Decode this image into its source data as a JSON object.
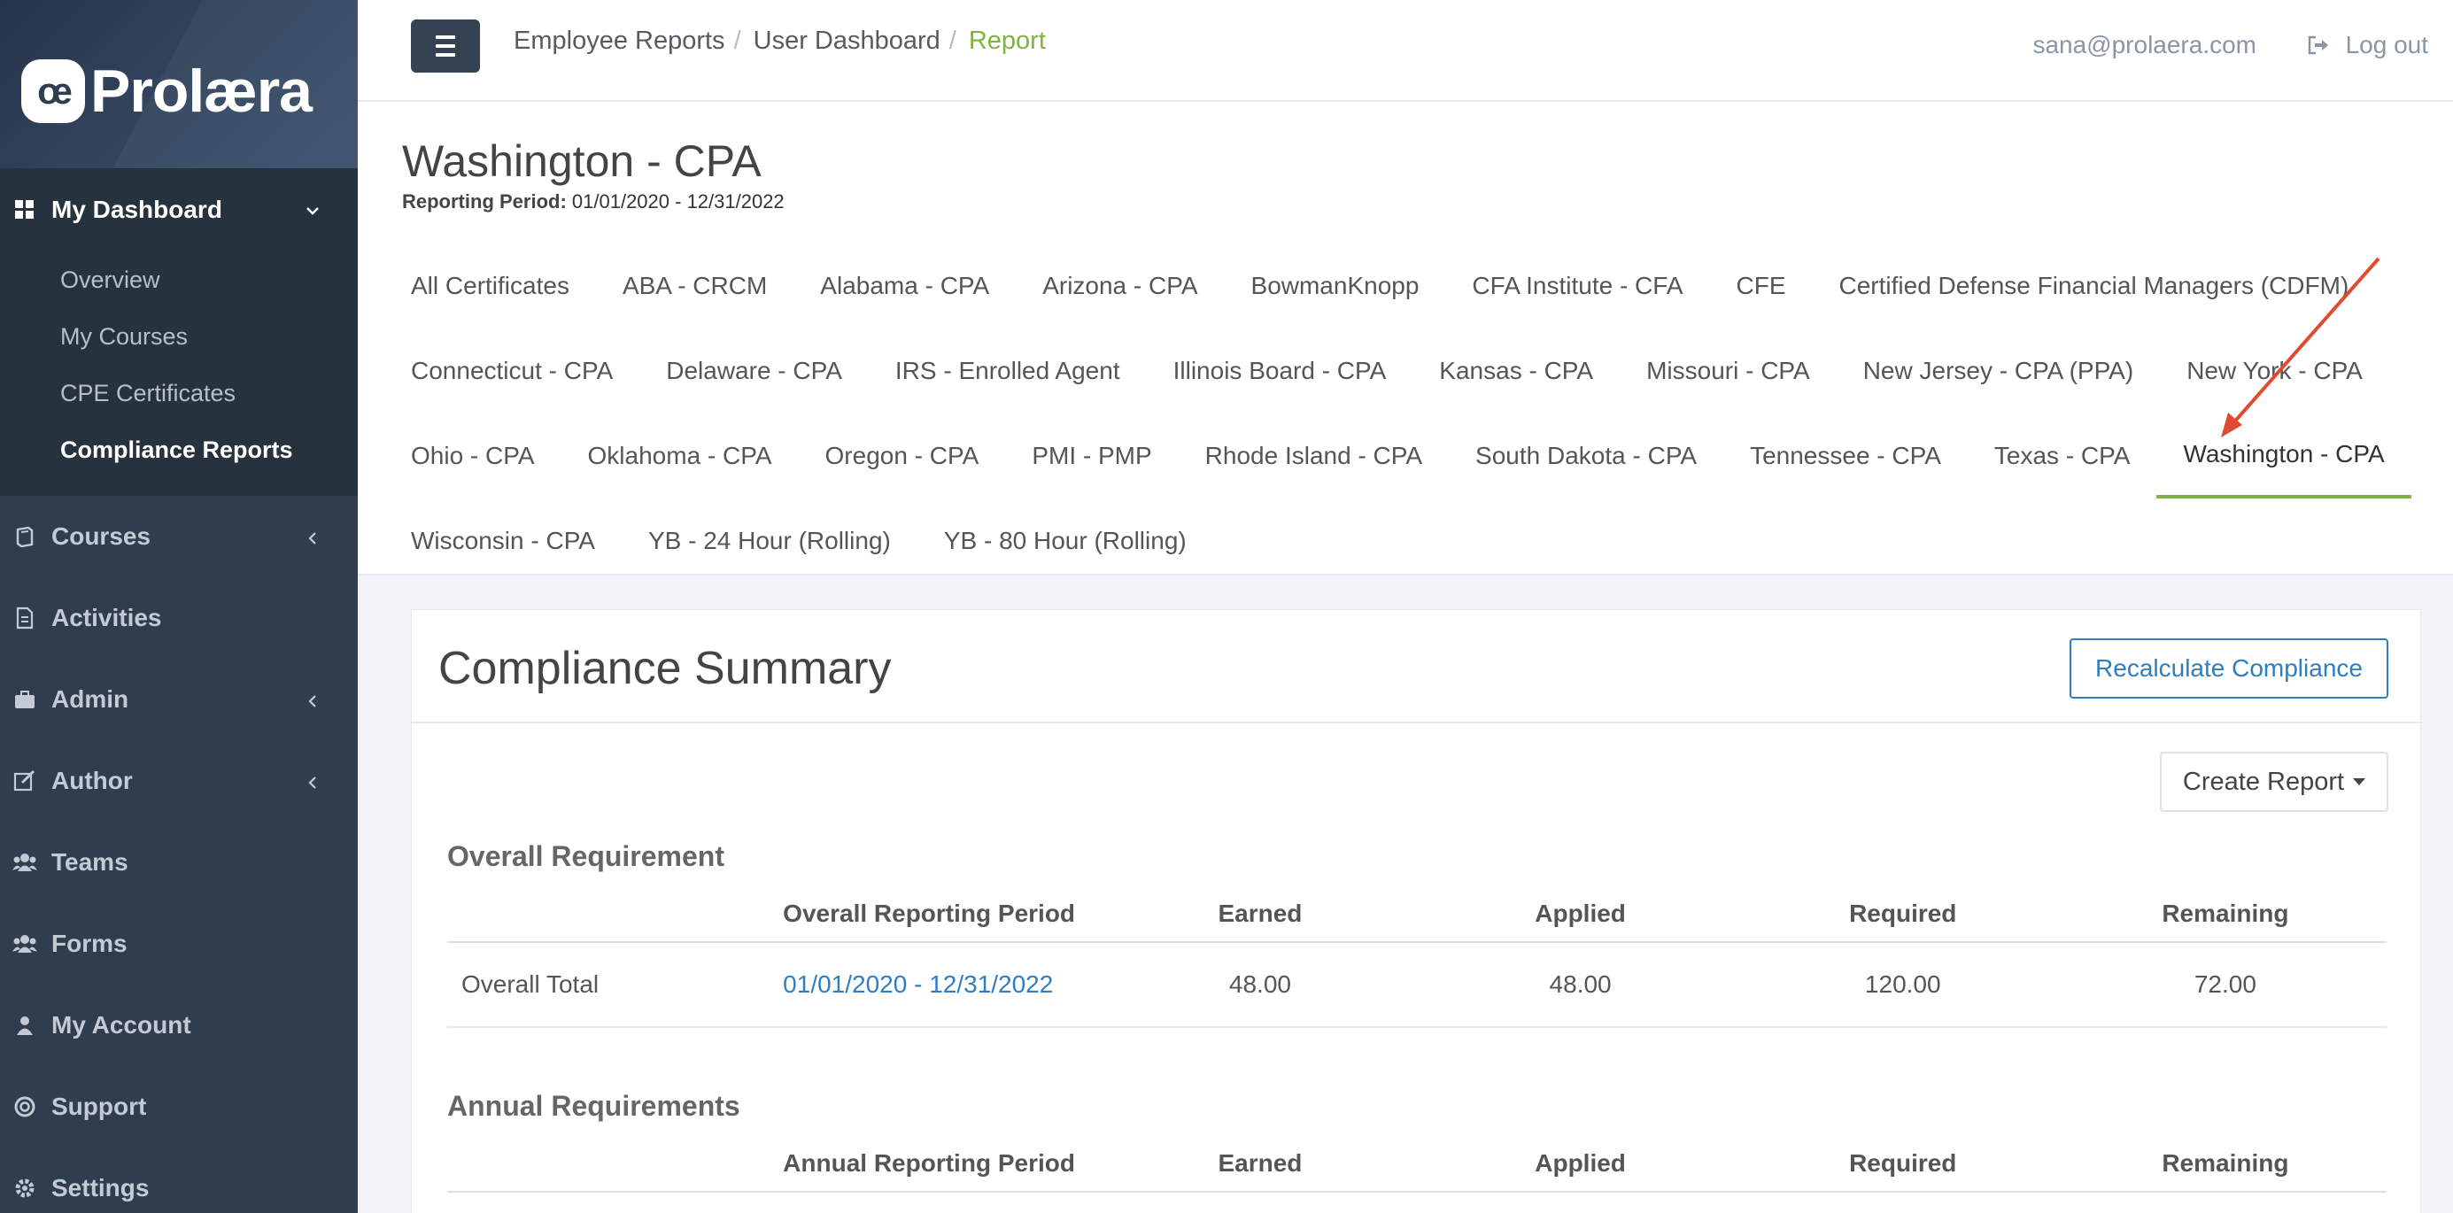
{
  "app": {
    "brand_badge": "œ",
    "brand_name": "Prolæra"
  },
  "sidebar": {
    "dashboard_label": "My Dashboard",
    "sub_items": [
      {
        "label": "Overview"
      },
      {
        "label": "My Courses"
      },
      {
        "label": "CPE Certificates"
      },
      {
        "label": "Compliance Reports"
      }
    ],
    "items": [
      {
        "label": "Courses",
        "icon": "book-icon"
      },
      {
        "label": "Activities",
        "icon": "document-icon"
      },
      {
        "label": "Admin",
        "icon": "briefcase-icon"
      },
      {
        "label": "Author",
        "icon": "edit-icon"
      },
      {
        "label": "Teams",
        "icon": "users-icon"
      },
      {
        "label": "Forms",
        "icon": "users-icon"
      },
      {
        "label": "My Account",
        "icon": "user-icon"
      },
      {
        "label": "Support",
        "icon": "lifebuoy-icon"
      },
      {
        "label": "Settings",
        "icon": "gear-icon"
      }
    ]
  },
  "header": {
    "breadcrumbs": [
      "Employee Reports",
      "User Dashboard",
      "Report"
    ],
    "breadcrumb_sep": "/",
    "user_email": "sana@prolaera.com",
    "logout_label": "Log out"
  },
  "page": {
    "title": "Washington - CPA",
    "period_label": "Reporting Period:",
    "period_value": "01/01/2020 - 12/31/2022"
  },
  "tabs": [
    [
      "All Certificates",
      "ABA - CRCM",
      "Alabama - CPA",
      "Arizona - CPA",
      "BowmanKnopp",
      "CFA Institute - CFA",
      "CFE",
      "Certified Defense Financial Managers (CDFM)"
    ],
    [
      "Connecticut - CPA",
      "Delaware - CPA",
      "IRS - Enrolled Agent",
      "Illinois Board - CPA",
      "Kansas - CPA",
      "Missouri - CPA",
      "New Jersey - CPA (PPA)",
      "New York - CPA"
    ],
    [
      "Ohio - CPA",
      "Oklahoma - CPA",
      "Oregon - CPA",
      "PMI - PMP",
      "Rhode Island - CPA",
      "South Dakota - CPA",
      "Tennessee - CPA",
      "Texas - CPA",
      "Washington - CPA"
    ],
    [
      "Wisconsin - CPA",
      "YB - 24 Hour (Rolling)",
      "YB - 80 Hour (Rolling)"
    ]
  ],
  "active_tab": "Washington - CPA",
  "summary": {
    "title": "Compliance Summary",
    "recalc_label": "Recalculate Compliance",
    "create_report_label": "Create Report",
    "overall": {
      "section_title": "Overall Requirement",
      "headers": [
        "",
        "Overall Reporting Period",
        "Earned",
        "Applied",
        "Required",
        "Remaining"
      ],
      "row": {
        "label": "Overall Total",
        "period": "01/01/2020 - 12/31/2022",
        "earned": "48.00",
        "applied": "48.00",
        "required": "120.00",
        "remaining": "72.00"
      }
    },
    "annual": {
      "section_title": "Annual Requirements",
      "headers": [
        "",
        "Annual Reporting Period",
        "Earned",
        "Applied",
        "Required",
        "Remaining"
      ]
    }
  },
  "colors": {
    "sidebar_bg": "#2f3d4e",
    "accent_green": "#7cb342",
    "link_blue": "#2f7ec1",
    "arrow_red": "#e04a2f"
  }
}
